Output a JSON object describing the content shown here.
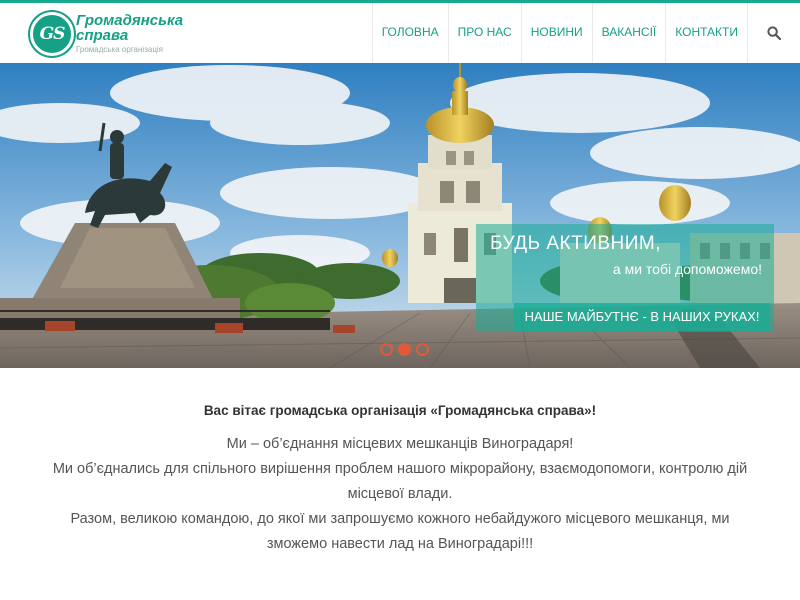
{
  "header": {
    "logo_mark": "GS",
    "logo_title_1": "Громадянська",
    "logo_title_2": "справа",
    "logo_subtitle": "Громадська організація",
    "nav": [
      "ГОЛОВНА",
      "ПРО НАС",
      "НОВИНИ",
      "ВАКАНСІЇ",
      "КОНТАКТИ"
    ],
    "search_icon": "search-icon"
  },
  "hero": {
    "caption_1": "БУДЬ АКТИВНИМ,",
    "caption_2": "а ми тобі допоможемо!",
    "caption_3": "НАШЕ МАЙБУТНЄ - В НАШИХ РУКАХ!",
    "slides_total": 3,
    "active_slide": 2,
    "accent": "#e05a3a"
  },
  "welcome": {
    "title": "Вас вітає громадська організація «Громадянська справа»!",
    "line_1": "Ми – об’єднання місцевих мешканців Виноградаря!",
    "line_2": "Ми об’єднались для спільного вирішення проблем нашого мікрорайону, взаємодопомоги, контролю дій місцевої влади.",
    "line_3": "Разом, великою командою, до якої ми запрошуємо кожного небайдужого місцевого мешканця, ми зможемо навести лад на Виноградарі!!!"
  },
  "colors": {
    "brand": "#16a085",
    "caption_bg": "#1aac96"
  }
}
